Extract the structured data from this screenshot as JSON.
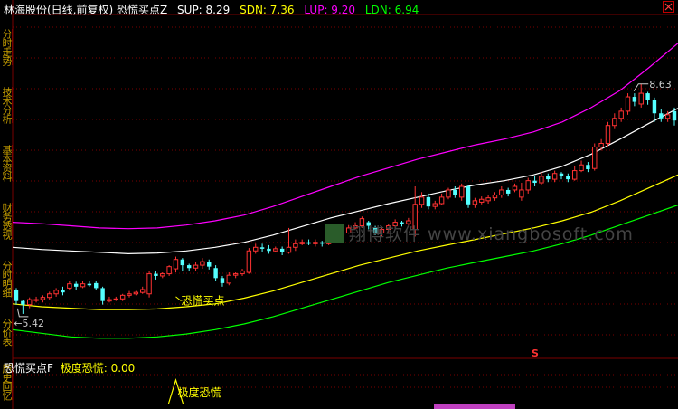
{
  "header": {
    "title": "林海股份(日线,前复权) 恐慌买点Z",
    "sup_label": "SUP: 8.29",
    "sdn_label": "SDN: 7.36",
    "lup_label": "LUP: 9.20",
    "ldn_label": "LDN: 6.94"
  },
  "sub_panel": {
    "title": "恐慌买点F",
    "value_label": "极度恐慌: 0.00",
    "signal_label": "极度恐慌"
  },
  "side_tabs": [
    "分时走势",
    "技术分析",
    "基本资料",
    "财务透视",
    "分时明细",
    "分价表",
    "历史回忆"
  ],
  "annotations": {
    "high_price": "8.63",
    "low_price": "5.42",
    "buy_signal": "恐慌买点",
    "marker": "S"
  },
  "watermark": "翔博软件 www.xiangbosoft.com",
  "colors": {
    "background": "#000000",
    "grid": "#7a0000",
    "up_candle": "#ff3232",
    "down_candle": "#54ffff",
    "sup": "#ffffff",
    "sdn": "#ffff00",
    "lup": "#ff00ff",
    "ldn": "#00ff00",
    "title": "#ffffff"
  },
  "chart_data": {
    "type": "candlestick",
    "title": "林海股份(日线,前复权) 恐慌买点Z",
    "ylim": [
      4.8,
      9.6
    ],
    "last_values": {
      "SUP": 8.29,
      "SDN": 7.36,
      "LUP": 9.2,
      "LDN": 6.94
    },
    "candles": [
      [
        5.75,
        5.6,
        5.78,
        5.55
      ],
      [
        5.6,
        5.55,
        5.62,
        5.42
      ],
      [
        5.55,
        5.62,
        5.65,
        5.5
      ],
      [
        5.62,
        5.62,
        5.66,
        5.58
      ],
      [
        5.62,
        5.65,
        5.68,
        5.58
      ],
      [
        5.65,
        5.7,
        5.73,
        5.62
      ],
      [
        5.7,
        5.75,
        5.78,
        5.66
      ],
      [
        5.75,
        5.72,
        5.8,
        5.68
      ],
      [
        5.78,
        5.84,
        5.88,
        5.76
      ],
      [
        5.84,
        5.8,
        5.87,
        5.76
      ],
      [
        5.8,
        5.84,
        5.88,
        5.78
      ],
      [
        5.84,
        5.82,
        5.88,
        5.8
      ],
      [
        5.85,
        5.78,
        5.88,
        5.75
      ],
      [
        5.78,
        5.6,
        5.8,
        5.55
      ],
      [
        5.6,
        5.62,
        5.66,
        5.58
      ],
      [
        5.62,
        5.63,
        5.66,
        5.6
      ],
      [
        5.63,
        5.68,
        5.7,
        5.6
      ],
      [
        5.68,
        5.7,
        5.74,
        5.65
      ],
      [
        5.7,
        5.72,
        5.74,
        5.68
      ],
      [
        5.72,
        5.76,
        5.8,
        5.7
      ],
      [
        5.7,
        5.98,
        6.02,
        5.65
      ],
      [
        5.98,
        5.95,
        6.02,
        5.9
      ],
      [
        5.95,
        5.98,
        6.0,
        5.92
      ],
      [
        5.98,
        6.08,
        6.1,
        5.95
      ],
      [
        6.05,
        6.18,
        6.22,
        6.0
      ],
      [
        6.18,
        6.1,
        6.2,
        6.02
      ],
      [
        6.1,
        6.06,
        6.12,
        6.02
      ],
      [
        6.06,
        6.1,
        6.14,
        6.02
      ],
      [
        6.1,
        6.15,
        6.2,
        6.05
      ],
      [
        6.15,
        6.08,
        6.18,
        6.04
      ],
      [
        6.06,
        5.92,
        6.1,
        5.88
      ],
      [
        5.92,
        5.85,
        5.95,
        5.8
      ],
      [
        5.85,
        5.96,
        6.0,
        5.82
      ],
      [
        5.96,
        5.98,
        6.0,
        5.92
      ],
      [
        5.98,
        6.02,
        6.05,
        5.95
      ],
      [
        6.0,
        6.3,
        6.34,
        5.98
      ],
      [
        6.3,
        6.35,
        6.4,
        6.26
      ],
      [
        6.35,
        6.33,
        6.4,
        6.28
      ],
      [
        6.33,
        6.3,
        6.38,
        6.26
      ],
      [
        6.3,
        6.33,
        6.36,
        6.28
      ],
      [
        6.33,
        6.28,
        6.36,
        6.24
      ],
      [
        6.28,
        6.35,
        6.62,
        6.26
      ],
      [
        6.35,
        6.4,
        6.46,
        6.3
      ],
      [
        6.4,
        6.42,
        6.46,
        6.38
      ],
      [
        6.42,
        6.4,
        6.46,
        6.38
      ],
      [
        6.4,
        6.42,
        6.46,
        6.36
      ],
      [
        6.42,
        6.4,
        6.44,
        6.36
      ],
      [
        6.4,
        6.44,
        6.48,
        6.38
      ],
      [
        6.52,
        6.5,
        6.56,
        6.46
      ],
      [
        6.52,
        6.55,
        6.6,
        6.5
      ],
      [
        6.55,
        6.62,
        6.66,
        6.54
      ],
      [
        6.62,
        6.65,
        6.7,
        6.6
      ],
      [
        6.65,
        6.75,
        6.78,
        6.62
      ],
      [
        6.7,
        6.65,
        6.72,
        6.6
      ],
      [
        6.62,
        6.55,
        6.65,
        6.52
      ],
      [
        6.55,
        6.6,
        6.64,
        6.5
      ],
      [
        6.6,
        6.65,
        6.68,
        6.56
      ],
      [
        6.65,
        6.7,
        6.74,
        6.62
      ],
      [
        6.7,
        6.68,
        6.72,
        6.64
      ],
      [
        6.68,
        6.72,
        6.76,
        6.66
      ],
      [
        6.6,
        6.95,
        7.2,
        6.5
      ],
      [
        6.95,
        7.05,
        7.12,
        6.9
      ],
      [
        7.05,
        6.92,
        7.1,
        6.88
      ],
      [
        6.92,
        6.96,
        7.0,
        6.88
      ],
      [
        6.96,
        7.05,
        7.1,
        6.94
      ],
      [
        7.05,
        7.15,
        7.18,
        7.02
      ],
      [
        7.15,
        7.08,
        7.2,
        7.04
      ],
      [
        7.05,
        7.2,
        7.24,
        7.0
      ],
      [
        7.2,
        6.95,
        7.22,
        6.9
      ],
      [
        6.95,
        7.0,
        7.04,
        6.9
      ],
      [
        6.98,
        7.02,
        7.06,
        6.95
      ],
      [
        7.0,
        7.04,
        7.08,
        6.96
      ],
      [
        7.04,
        7.08,
        7.12,
        7.0
      ],
      [
        7.08,
        7.15,
        7.2,
        7.04
      ],
      [
        7.15,
        7.1,
        7.18,
        7.06
      ],
      [
        7.15,
        7.2,
        7.24,
        7.12
      ],
      [
        7.05,
        7.15,
        7.25,
        7.0
      ],
      [
        7.15,
        7.28,
        7.32,
        7.1
      ],
      [
        7.28,
        7.25,
        7.34,
        7.2
      ],
      [
        7.25,
        7.34,
        7.4,
        7.22
      ],
      [
        7.34,
        7.3,
        7.38,
        7.26
      ],
      [
        7.3,
        7.38,
        7.42,
        7.26
      ],
      [
        7.38,
        7.34,
        7.4,
        7.3
      ],
      [
        7.34,
        7.3,
        7.38,
        7.26
      ],
      [
        7.3,
        7.42,
        7.48,
        7.28
      ],
      [
        7.42,
        7.5,
        7.56,
        7.4
      ],
      [
        7.5,
        7.44,
        7.54,
        7.4
      ],
      [
        7.45,
        7.75,
        7.8,
        7.42
      ],
      [
        7.75,
        7.8,
        7.86,
        7.7
      ],
      [
        7.8,
        8.05,
        8.1,
        7.76
      ],
      [
        8.05,
        8.15,
        8.22,
        8.0
      ],
      [
        8.15,
        8.25,
        8.3,
        8.1
      ],
      [
        8.25,
        8.45,
        8.5,
        8.2
      ],
      [
        8.45,
        8.38,
        8.5,
        8.32
      ],
      [
        8.35,
        8.5,
        8.63,
        8.3
      ],
      [
        8.5,
        8.4,
        8.52,
        8.34
      ],
      [
        8.4,
        8.22,
        8.44,
        8.1
      ],
      [
        8.22,
        8.15,
        8.28,
        8.1
      ],
      [
        8.15,
        8.2,
        8.25,
        8.1
      ],
      [
        8.25,
        8.12,
        8.3,
        8.05
      ]
    ],
    "sup_line": [
      6.35,
      6.32,
      6.3,
      6.28,
      6.26,
      6.27,
      6.3,
      6.35,
      6.42,
      6.52,
      6.64,
      6.76,
      6.86,
      6.96,
      7.05,
      7.14,
      7.22,
      7.28,
      7.36,
      7.48,
      7.65,
      7.86,
      8.08,
      8.29
    ],
    "sdn_line": [
      5.56,
      5.52,
      5.5,
      5.48,
      5.48,
      5.49,
      5.52,
      5.56,
      5.64,
      5.74,
      5.86,
      5.98,
      6.1,
      6.2,
      6.3,
      6.38,
      6.46,
      6.54,
      6.62,
      6.72,
      6.84,
      7.0,
      7.18,
      7.36
    ],
    "lup_line": [
      6.7,
      6.68,
      6.65,
      6.62,
      6.61,
      6.62,
      6.66,
      6.72,
      6.8,
      6.92,
      7.06,
      7.2,
      7.34,
      7.46,
      7.58,
      7.68,
      7.78,
      7.86,
      7.96,
      8.1,
      8.3,
      8.54,
      8.86,
      9.2
    ],
    "ldn_line": [
      5.2,
      5.15,
      5.1,
      5.08,
      5.08,
      5.1,
      5.14,
      5.2,
      5.28,
      5.38,
      5.5,
      5.62,
      5.74,
      5.86,
      5.96,
      6.06,
      6.14,
      6.22,
      6.3,
      6.4,
      6.52,
      6.66,
      6.8,
      6.94
    ]
  }
}
